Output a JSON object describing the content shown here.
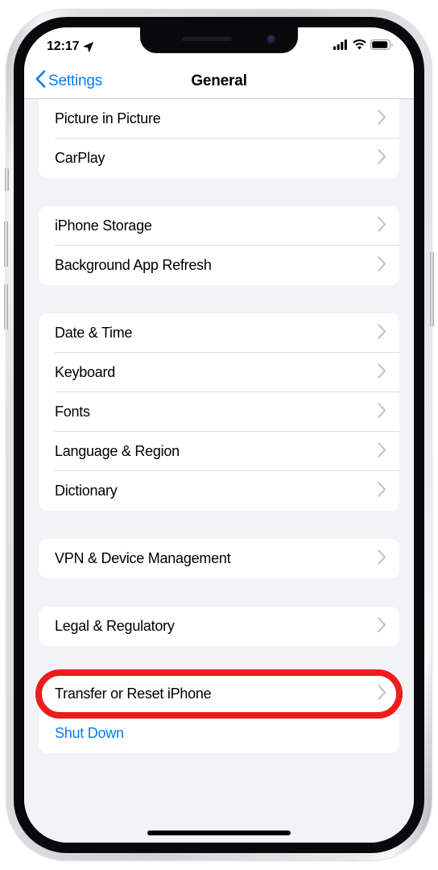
{
  "status_bar": {
    "time": "12:17",
    "location_icon": "location-arrow-icon",
    "cellular_icon": "cellular-bars-icon",
    "wifi_icon": "wifi-icon",
    "battery_icon": "battery-icon"
  },
  "nav": {
    "back_label": "Settings",
    "back_icon": "chevron-left-icon",
    "title": "General"
  },
  "colors": {
    "accent_blue": "#0a7bf7",
    "annotation_red": "#ec1c1c",
    "background": "#f2f2f7",
    "card": "#ffffff",
    "chevron_gray": "#c3c3c7"
  },
  "groups": [
    {
      "name": "display-group",
      "clipped_top": true,
      "rows": [
        {
          "label": "Picture in Picture",
          "accessory": "chevron-right-icon",
          "style": "default"
        },
        {
          "label": "CarPlay",
          "accessory": "chevron-right-icon",
          "style": "default"
        }
      ]
    },
    {
      "name": "storage-group",
      "clipped_top": false,
      "rows": [
        {
          "label": "iPhone Storage",
          "accessory": "chevron-right-icon",
          "style": "default"
        },
        {
          "label": "Background App Refresh",
          "accessory": "chevron-right-icon",
          "style": "default"
        }
      ]
    },
    {
      "name": "localization-group",
      "clipped_top": false,
      "rows": [
        {
          "label": "Date & Time",
          "accessory": "chevron-right-icon",
          "style": "default"
        },
        {
          "label": "Keyboard",
          "accessory": "chevron-right-icon",
          "style": "default"
        },
        {
          "label": "Fonts",
          "accessory": "chevron-right-icon",
          "style": "default"
        },
        {
          "label": "Language & Region",
          "accessory": "chevron-right-icon",
          "style": "default"
        },
        {
          "label": "Dictionary",
          "accessory": "chevron-right-icon",
          "style": "default"
        }
      ]
    },
    {
      "name": "vpn-group",
      "clipped_top": false,
      "rows": [
        {
          "label": "VPN & Device Management",
          "accessory": "chevron-right-icon",
          "style": "default"
        }
      ]
    },
    {
      "name": "legal-group",
      "clipped_top": false,
      "rows": [
        {
          "label": "Legal & Regulatory",
          "accessory": "chevron-right-icon",
          "style": "default"
        }
      ]
    },
    {
      "name": "reset-group",
      "clipped_top": false,
      "rows": [
        {
          "label": "Transfer or Reset iPhone",
          "accessory": "chevron-right-icon",
          "style": "default",
          "annotated": true
        },
        {
          "label": "Shut Down",
          "accessory": "none",
          "style": "link"
        }
      ]
    }
  ]
}
